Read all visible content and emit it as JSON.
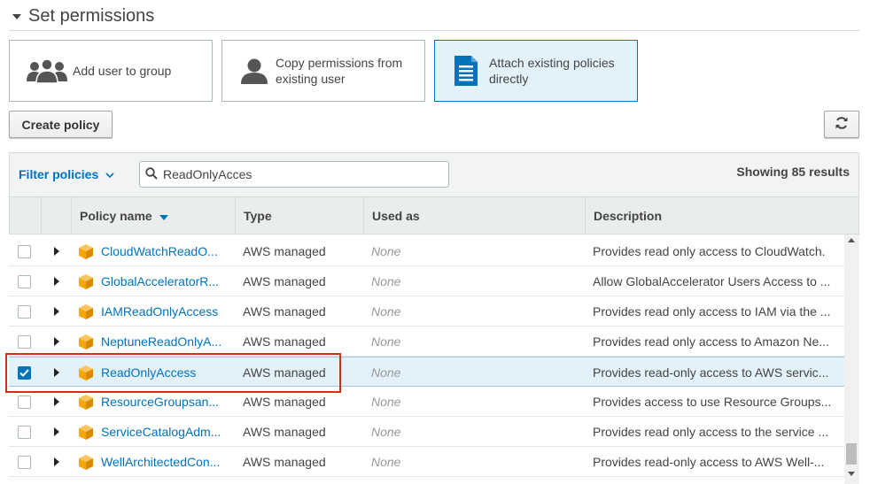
{
  "section": {
    "title": "Set permissions"
  },
  "options": [
    {
      "label_line1": "Add user to group",
      "label_line2": "",
      "icon": "group-icon",
      "selected": false
    },
    {
      "label_line1": "Copy permissions from",
      "label_line2": "existing user",
      "icon": "user-icon",
      "selected": false
    },
    {
      "label_line1": "Attach existing policies",
      "label_line2": "directly",
      "icon": "document-icon",
      "selected": true
    }
  ],
  "toolbar": {
    "create_policy_label": "Create policy",
    "refresh_icon": "refresh-icon"
  },
  "filter": {
    "label": "Filter policies",
    "search_value": "ReadOnlyAcces",
    "results_text": "Showing 85 results"
  },
  "table": {
    "columns": [
      "Policy name",
      "Type",
      "Used as",
      "Description"
    ],
    "sort_column": "Policy name",
    "rows": [
      {
        "checked": false,
        "name": "CloudWatchReadO...",
        "type": "AWS managed",
        "used_as": "None",
        "description": "Provides read only access to CloudWatch."
      },
      {
        "checked": false,
        "name": "GlobalAcceleratorR...",
        "type": "AWS managed",
        "used_as": "None",
        "description": "Allow GlobalAccelerator Users Access to ..."
      },
      {
        "checked": false,
        "name": "IAMReadOnlyAccess",
        "type": "AWS managed",
        "used_as": "None",
        "description": "Provides read only access to IAM via the ..."
      },
      {
        "checked": false,
        "name": "NeptuneReadOnlyA...",
        "type": "AWS managed",
        "used_as": "None",
        "description": "Provides read only access to Amazon Ne..."
      },
      {
        "checked": true,
        "name": "ReadOnlyAccess",
        "type": "AWS managed",
        "used_as": "None",
        "description": "Provides read-only access to AWS servic..."
      },
      {
        "checked": false,
        "name": "ResourceGroupsan...",
        "type": "AWS managed",
        "used_as": "None",
        "description": "Provides access to use Resource Groups..."
      },
      {
        "checked": false,
        "name": "ServiceCatalogAdm...",
        "type": "AWS managed",
        "used_as": "None",
        "description": "Provides read only access to the service ..."
      },
      {
        "checked": false,
        "name": "WellArchitectedCon...",
        "type": "AWS managed",
        "used_as": "None",
        "description": "Provides read-only access to AWS Well-..."
      }
    ]
  },
  "colors": {
    "accent": "#0073bb",
    "selected_bg": "#e3f1fa",
    "policy_icon": "#f7a800",
    "highlight": "#d13212"
  }
}
